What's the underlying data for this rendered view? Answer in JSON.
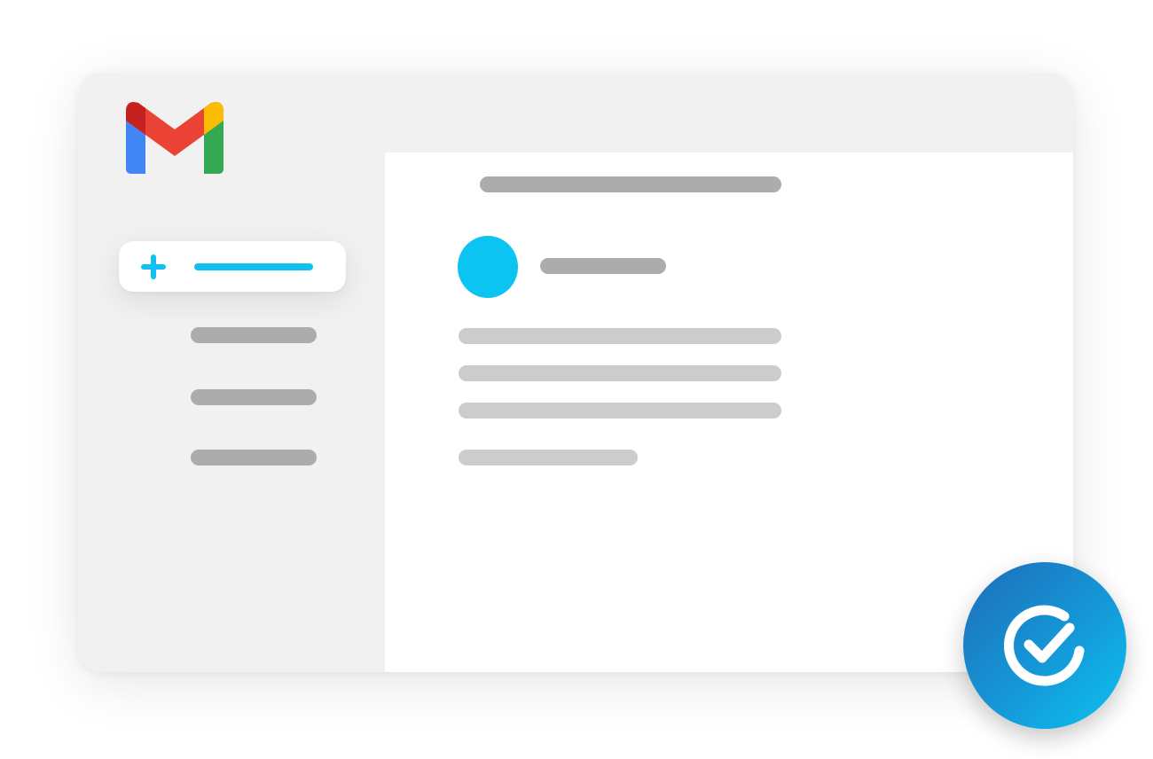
{
  "icons": {
    "logo": "gmail-logo",
    "compose": "plus-icon",
    "badge": "check-circle-icon"
  },
  "colors": {
    "accent": "#12c0ef",
    "avatar": "#0cc4f1",
    "placeholder_dark": "#acacac",
    "placeholder_light": "#cccccc",
    "gmail_red": "#ea4335",
    "gmail_blue": "#4285f4",
    "gmail_green": "#34a853",
    "gmail_yellow": "#fbbc04",
    "badge_start": "#1d6db8",
    "badge_end": "#0cc2ef"
  }
}
